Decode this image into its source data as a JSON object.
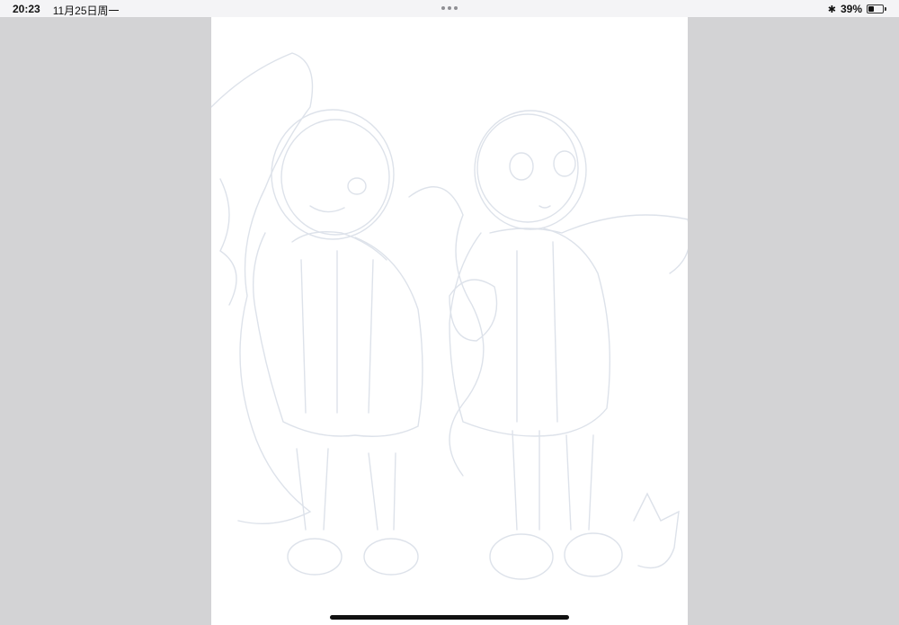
{
  "status_bar": {
    "time": "20:23",
    "date": "11月25日周一",
    "battery_percent": "39%",
    "battery_level": 0.39,
    "bluetooth_icon": "bluetooth-icon"
  },
  "canvas": {
    "background": "#ffffff",
    "stroke_color": "#dde2ea"
  },
  "colors": {
    "side_panel": "#d3d3d5",
    "status_bar_bg": "#f4f4f6"
  }
}
